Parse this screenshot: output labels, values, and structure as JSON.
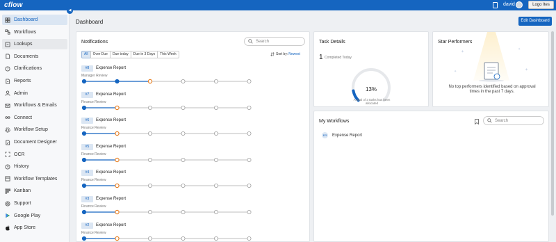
{
  "topbar": {
    "logo": "cflow",
    "user": "david",
    "logout_label": "Logo Ites"
  },
  "sidebar": {
    "items": [
      {
        "label": "Dashboard",
        "icon": "dashboard-icon"
      },
      {
        "label": "Workflows",
        "icon": "workflows-icon"
      },
      {
        "label": "Lookups",
        "icon": "lookups-icon"
      },
      {
        "label": "Documents",
        "icon": "documents-icon"
      },
      {
        "label": "Clarifications",
        "icon": "clarifications-icon"
      },
      {
        "label": "Reports",
        "icon": "reports-icon"
      },
      {
        "label": "Admin",
        "icon": "admin-icon"
      },
      {
        "label": "Workflows & Emails",
        "icon": "workflows-emails-icon"
      },
      {
        "label": "Connect",
        "icon": "connect-icon"
      },
      {
        "label": "Workflow Setup",
        "icon": "workflow-setup-icon"
      },
      {
        "label": "Document Designer",
        "icon": "document-designer-icon"
      },
      {
        "label": "OCR",
        "icon": "ocr-icon"
      },
      {
        "label": "History",
        "icon": "history-icon"
      },
      {
        "label": "Workflow Templates",
        "icon": "workflow-templates-icon"
      },
      {
        "label": "Kanban",
        "icon": "kanban-icon"
      },
      {
        "label": "Support",
        "icon": "support-icon"
      },
      {
        "label": "Google Play",
        "icon": "google-play-icon"
      },
      {
        "label": "App Store",
        "icon": "app-store-icon"
      }
    ]
  },
  "header": {
    "title": "Dashboard",
    "edit_label": "Edit Dashboard"
  },
  "notifications": {
    "title": "Notifications",
    "search_placeholder": "Search",
    "filters": [
      "All",
      "Over Due",
      "Due today",
      "Due in 3 Days",
      "This Week"
    ],
    "active_filter": "All",
    "sort_label": "Sort by:",
    "sort_value": "Newest",
    "items": [
      {
        "id": "#8",
        "name": "Expense Report",
        "stage": "Manager Review",
        "completed_steps": 1,
        "current_step": 2,
        "steps": 6
      },
      {
        "id": "#7",
        "name": "Expense Report",
        "stage": "Finance Review",
        "completed_steps": 0,
        "current_step": 1,
        "steps": 6
      },
      {
        "id": "#6",
        "name": "Expense Report",
        "stage": "Finance Review",
        "completed_steps": 0,
        "current_step": 1,
        "steps": 6
      },
      {
        "id": "#5",
        "name": "Expense Report",
        "stage": "Finance Review",
        "completed_steps": 0,
        "current_step": 1,
        "steps": 6
      },
      {
        "id": "#4",
        "name": "Expense Report",
        "stage": "Finance Review",
        "completed_steps": 0,
        "current_step": 1,
        "steps": 6
      },
      {
        "id": "#3",
        "name": "Expense Report",
        "stage": "Finance Review",
        "completed_steps": 0,
        "current_step": 1,
        "steps": 6
      },
      {
        "id": "#2",
        "name": "Expense Report",
        "stage": "Finance Review",
        "completed_steps": 0,
        "current_step": 1,
        "steps": 6
      }
    ]
  },
  "task_details": {
    "title": "Task Details",
    "completed_count": "1",
    "completed_label": "Completed Today",
    "percent": 13,
    "percent_label": "13%",
    "note": "A total of 3 tasks has been allocated"
  },
  "star_performers": {
    "title": "Star Performers",
    "message": "No top performers identified based on approval times in the past 7 days."
  },
  "my_workflows": {
    "title": "My Workflows",
    "search_placeholder": "Search",
    "items": [
      {
        "initials": "ER",
        "label": "Expense Report"
      }
    ]
  },
  "colors": {
    "primary": "#1565c0",
    "current_step": "#e8832a",
    "track": "#bdbdbd"
  }
}
